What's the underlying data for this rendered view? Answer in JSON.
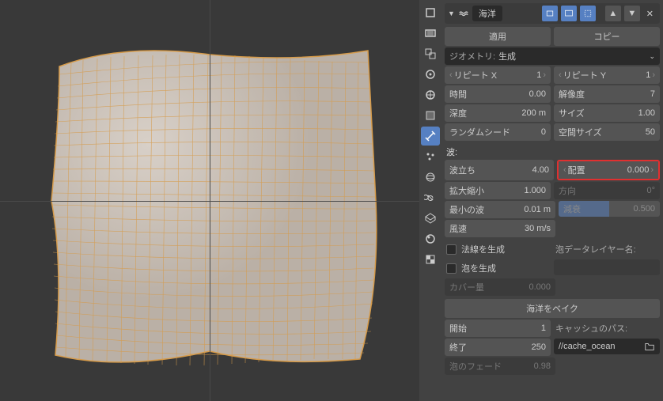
{
  "modifier": {
    "name": "海洋",
    "apply": "適用",
    "copy": "コピー"
  },
  "geometry": {
    "label": "ジオメトリ:",
    "value": "生成"
  },
  "fields": {
    "repeatX": {
      "label": "リピート X",
      "value": "1"
    },
    "repeatY": {
      "label": "リピート Y",
      "value": "1"
    },
    "time": {
      "label": "時間",
      "value": "0.00"
    },
    "resolution": {
      "label": "解像度",
      "value": "7"
    },
    "depth": {
      "label": "深度",
      "value": "200 m"
    },
    "size": {
      "label": "サイズ",
      "value": "1.00"
    },
    "randomSeed": {
      "label": "ランダムシード",
      "value": "0"
    },
    "spatialSize": {
      "label": "空間サイズ",
      "value": "50"
    }
  },
  "waves": {
    "title": "波:",
    "choppiness": {
      "label": "波立ち",
      "value": "4.00"
    },
    "alignment": {
      "label": "配置",
      "value": "0.000"
    },
    "scale": {
      "label": "拡大縮小",
      "value": "1.000"
    },
    "direction": {
      "label": "方向",
      "value": "0°"
    },
    "smallestWave": {
      "label": "最小の波",
      "value": "0.01 m"
    },
    "damping": {
      "label": "減衰",
      "value": "0.500"
    },
    "windVelocity": {
      "label": "風速",
      "value": "30 m/s"
    }
  },
  "checks": {
    "normals": "法線を生成",
    "foam": "泡を生成",
    "foamLayerLabel": "泡データレイヤー名:"
  },
  "coverage": {
    "label": "カバー量",
    "value": "0.000"
  },
  "bake": {
    "button": "海洋をベイク",
    "start": {
      "label": "開始",
      "value": "1"
    },
    "end": {
      "label": "終了",
      "value": "250"
    },
    "cachePathLabel": "キャッシュのパス:",
    "cachePath": "//cache_ocean",
    "foamFade": {
      "label": "泡のフェード",
      "value": "0.98"
    }
  }
}
